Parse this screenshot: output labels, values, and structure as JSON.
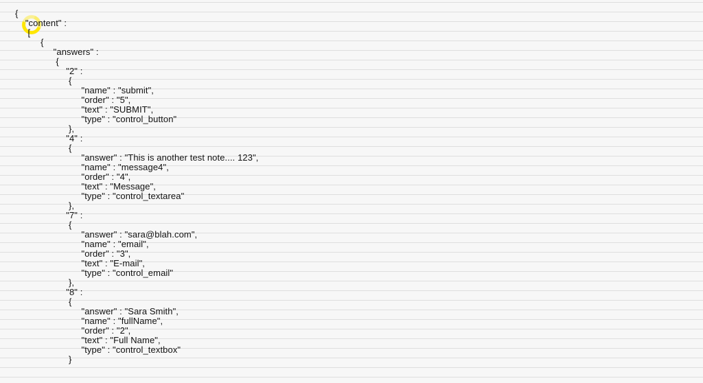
{
  "json_text": "{\n    \"content\" :\n     [\n          {\n               \"answers\" :\n                {\n                    \"2\" :\n                     {\n                          \"name\" : \"submit\",\n                          \"order\" : \"5\",\n                          \"text\" : \"SUBMIT\",\n                          \"type\" : \"control_button\"\n                     },\n                    \"4\" :\n                     {\n                          \"answer\" : \"This is another test note.... 123\",\n                          \"name\" : \"message4\",\n                          \"order\" : \"4\",\n                          \"text\" : \"Message\",\n                          \"type\" : \"control_textarea\"\n                     },\n                    \"7\" :\n                     {\n                          \"answer\" : \"sara@blah.com\",\n                          \"name\" : \"email\",\n                          \"order\" : \"3\",\n                          \"text\" : \"E-mail\",\n                          \"type\" : \"control_email\"\n                     },\n                    \"8\" :\n                     {\n                          \"answer\" : \"Sara Smith\",\n                          \"name\" : \"fullName\",\n                          \"order\" : \"2\",\n                          \"text\" : \"Full Name\",\n                          \"type\" : \"control_textbox\"\n                     }",
  "annotation": {
    "target": "content-array-open-bracket",
    "shape": "yellow-circle"
  }
}
